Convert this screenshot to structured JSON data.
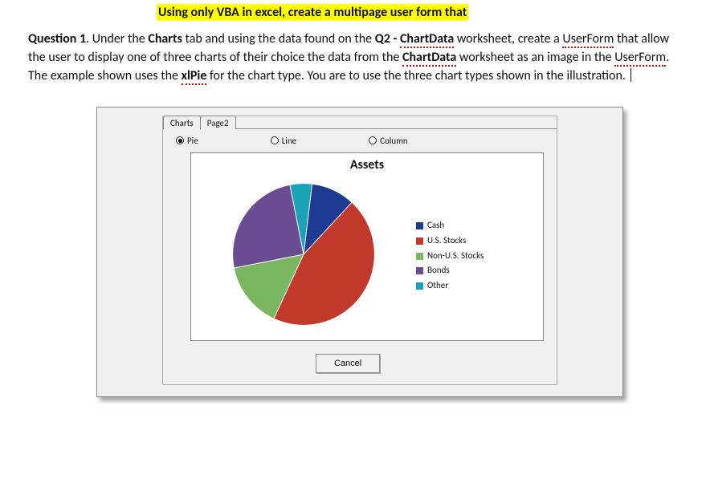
{
  "heading": "Using only VBA in excel, create a multipage user form that",
  "question": {
    "label": "Question 1",
    "t_under_the": ".   Under the ",
    "t_charts": "Charts",
    "t_tab_using": " tab and using the data found on the ",
    "t_q2": "Q2 - ",
    "t_chartdata1": "ChartData",
    "t_worksheet1": " worksheet, create a ",
    "t_userform1": "UserForm",
    "t_allow": " that allow the user to display one of three charts of their choice the data from the ",
    "t_chartdata2": "ChartData",
    "t_worksheet2": " worksheet as an image in the ",
    "t_userform2": "UserForm",
    "t_example": ".  The example shown uses the ",
    "t_xlpie": "xlPie",
    "t_charttype": " for the chart type.    You are to use the three chart types shown in the illustration.  "
  },
  "userform": {
    "tabs": [
      "Charts",
      "Page2"
    ],
    "radios": {
      "pie": "Pie",
      "line": "Line",
      "column": "Column"
    },
    "chart_title": "Assets",
    "cancel": "Cancel"
  },
  "legend": {
    "cash": {
      "label": "Cash",
      "color": "#1f3a93"
    },
    "us": {
      "label": "U.S. Stocks",
      "color": "#c0392b"
    },
    "nonus": {
      "label": "Non-U.S. Stocks",
      "color": "#7bb661"
    },
    "bonds": {
      "label": "Bonds",
      "color": "#6a4c93"
    },
    "other": {
      "label": "Other",
      "color": "#1aa3b8"
    }
  },
  "chart_data": {
    "type": "pie",
    "title": "Assets",
    "categories": [
      "Cash",
      "U.S. Stocks",
      "Non-U.S. Stocks",
      "Bonds",
      "Other"
    ],
    "series": [
      {
        "name": "Assets",
        "values": [
          10,
          45,
          15,
          25,
          5
        ]
      }
    ],
    "colors": [
      "#1f3a93",
      "#c0392b",
      "#7bb661",
      "#6a4c93",
      "#1aa3b8"
    ],
    "xlabel": "",
    "ylabel": "",
    "ylim": null,
    "legend_position": "right"
  }
}
